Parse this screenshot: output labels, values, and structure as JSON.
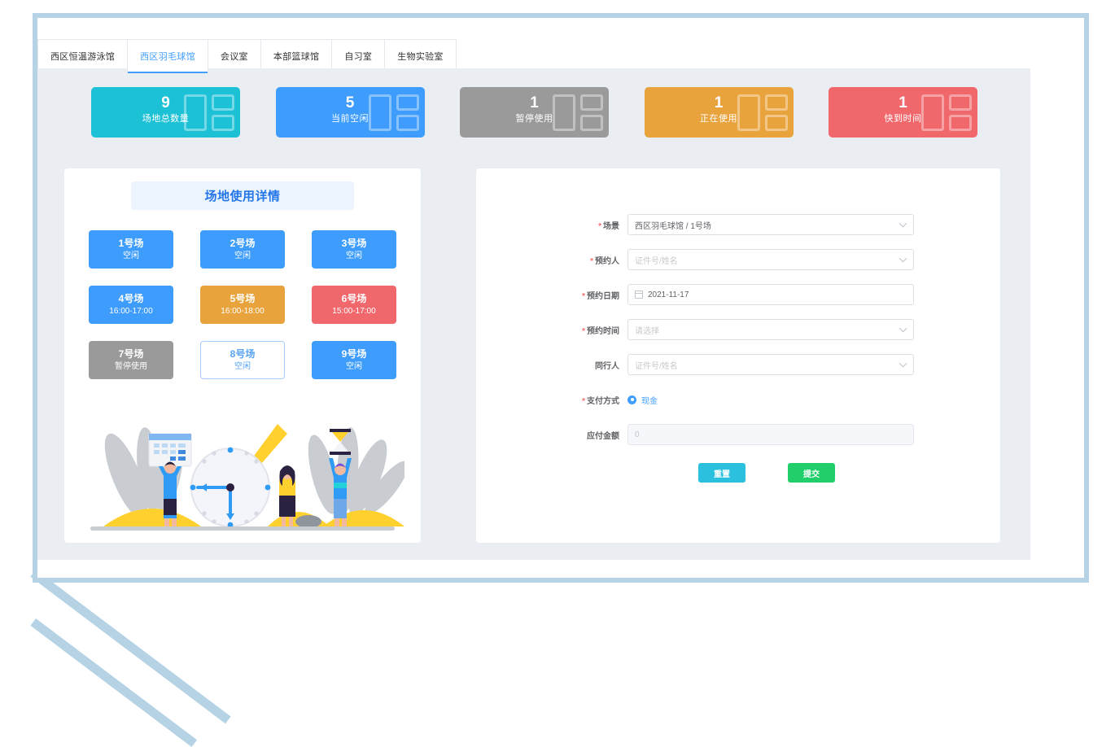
{
  "frame": {
    "accent_color": "#b5d3e5"
  },
  "tabs": [
    {
      "label": "西区恒温游泳馆",
      "active": false,
      "name": "tab-west-swimming-pool"
    },
    {
      "label": "西区羽毛球馆",
      "active": true,
      "name": "tab-west-badminton"
    },
    {
      "label": "会议室",
      "active": false,
      "name": "tab-meeting-room"
    },
    {
      "label": "本部篮球馆",
      "active": false,
      "name": "tab-main-basketball"
    },
    {
      "label": "自习室",
      "active": false,
      "name": "tab-study-room"
    },
    {
      "label": "生物实验室",
      "active": false,
      "name": "tab-bio-lab"
    }
  ],
  "stats": [
    {
      "value": "9",
      "label": "场地总数量",
      "color": "#1cc1d6",
      "name": "stat-card-total-courts"
    },
    {
      "value": "5",
      "label": "当前空闲",
      "color": "#3d9cfc",
      "name": "stat-card-available"
    },
    {
      "value": "1",
      "label": "暂停使用",
      "color": "#9a9a9a",
      "name": "stat-card-suspended"
    },
    {
      "value": "1",
      "label": "正在使用",
      "color": "#e8a33d",
      "name": "stat-card-in-use"
    },
    {
      "value": "1",
      "label": "快到时间",
      "color": "#f0686c",
      "name": "stat-card-expiring"
    }
  ],
  "courts_panel": {
    "title": "场地使用详情",
    "title_color": "#2376e8",
    "courts": [
      {
        "name": "1号场",
        "status": "空闲",
        "color": "#3d9cfc",
        "selected": false
      },
      {
        "name": "2号场",
        "status": "空闲",
        "color": "#3d9cfc",
        "selected": false
      },
      {
        "name": "3号场",
        "status": "空闲",
        "color": "#3d9cfc",
        "selected": false
      },
      {
        "name": "4号场",
        "status": "16:00-17:00",
        "color": "#3d9cfc",
        "selected": false
      },
      {
        "name": "5号场",
        "status": "16:00-18:00",
        "color": "#e8a33d",
        "selected": false
      },
      {
        "name": "6号场",
        "status": "15:00-17:00",
        "color": "#f0686c",
        "selected": false
      },
      {
        "name": "7号场",
        "status": "暂停使用",
        "color": "#9a9a9a",
        "selected": false
      },
      {
        "name": "8号场",
        "status": "空闲",
        "color": "#ffffff",
        "selected": true
      },
      {
        "name": "9号场",
        "status": "空闲",
        "color": "#3d9cfc",
        "selected": false
      }
    ]
  },
  "form": {
    "venue": {
      "label": "场景",
      "required": true,
      "value": "西区羽毛球馆 / 1号场",
      "is_placeholder": false
    },
    "booker": {
      "label": "预约人",
      "required": true,
      "placeholder": "证件号/姓名",
      "is_placeholder": true
    },
    "date": {
      "label": "预约日期",
      "required": true,
      "value": "2021-11-17",
      "is_placeholder": false
    },
    "time": {
      "label": "预约时间",
      "required": true,
      "placeholder": "请选择",
      "is_placeholder": true
    },
    "companion": {
      "label": "同行人",
      "required": false,
      "placeholder": "证件号/姓名",
      "is_placeholder": true
    },
    "payment": {
      "label": "支付方式",
      "required": true,
      "option": "现金"
    },
    "amount": {
      "label": "应付金额",
      "required": false,
      "value": "0"
    },
    "reset_label": "重置",
    "submit_label": "提交",
    "reset_color": "#2bc0dd",
    "submit_color": "#20cf6a"
  }
}
